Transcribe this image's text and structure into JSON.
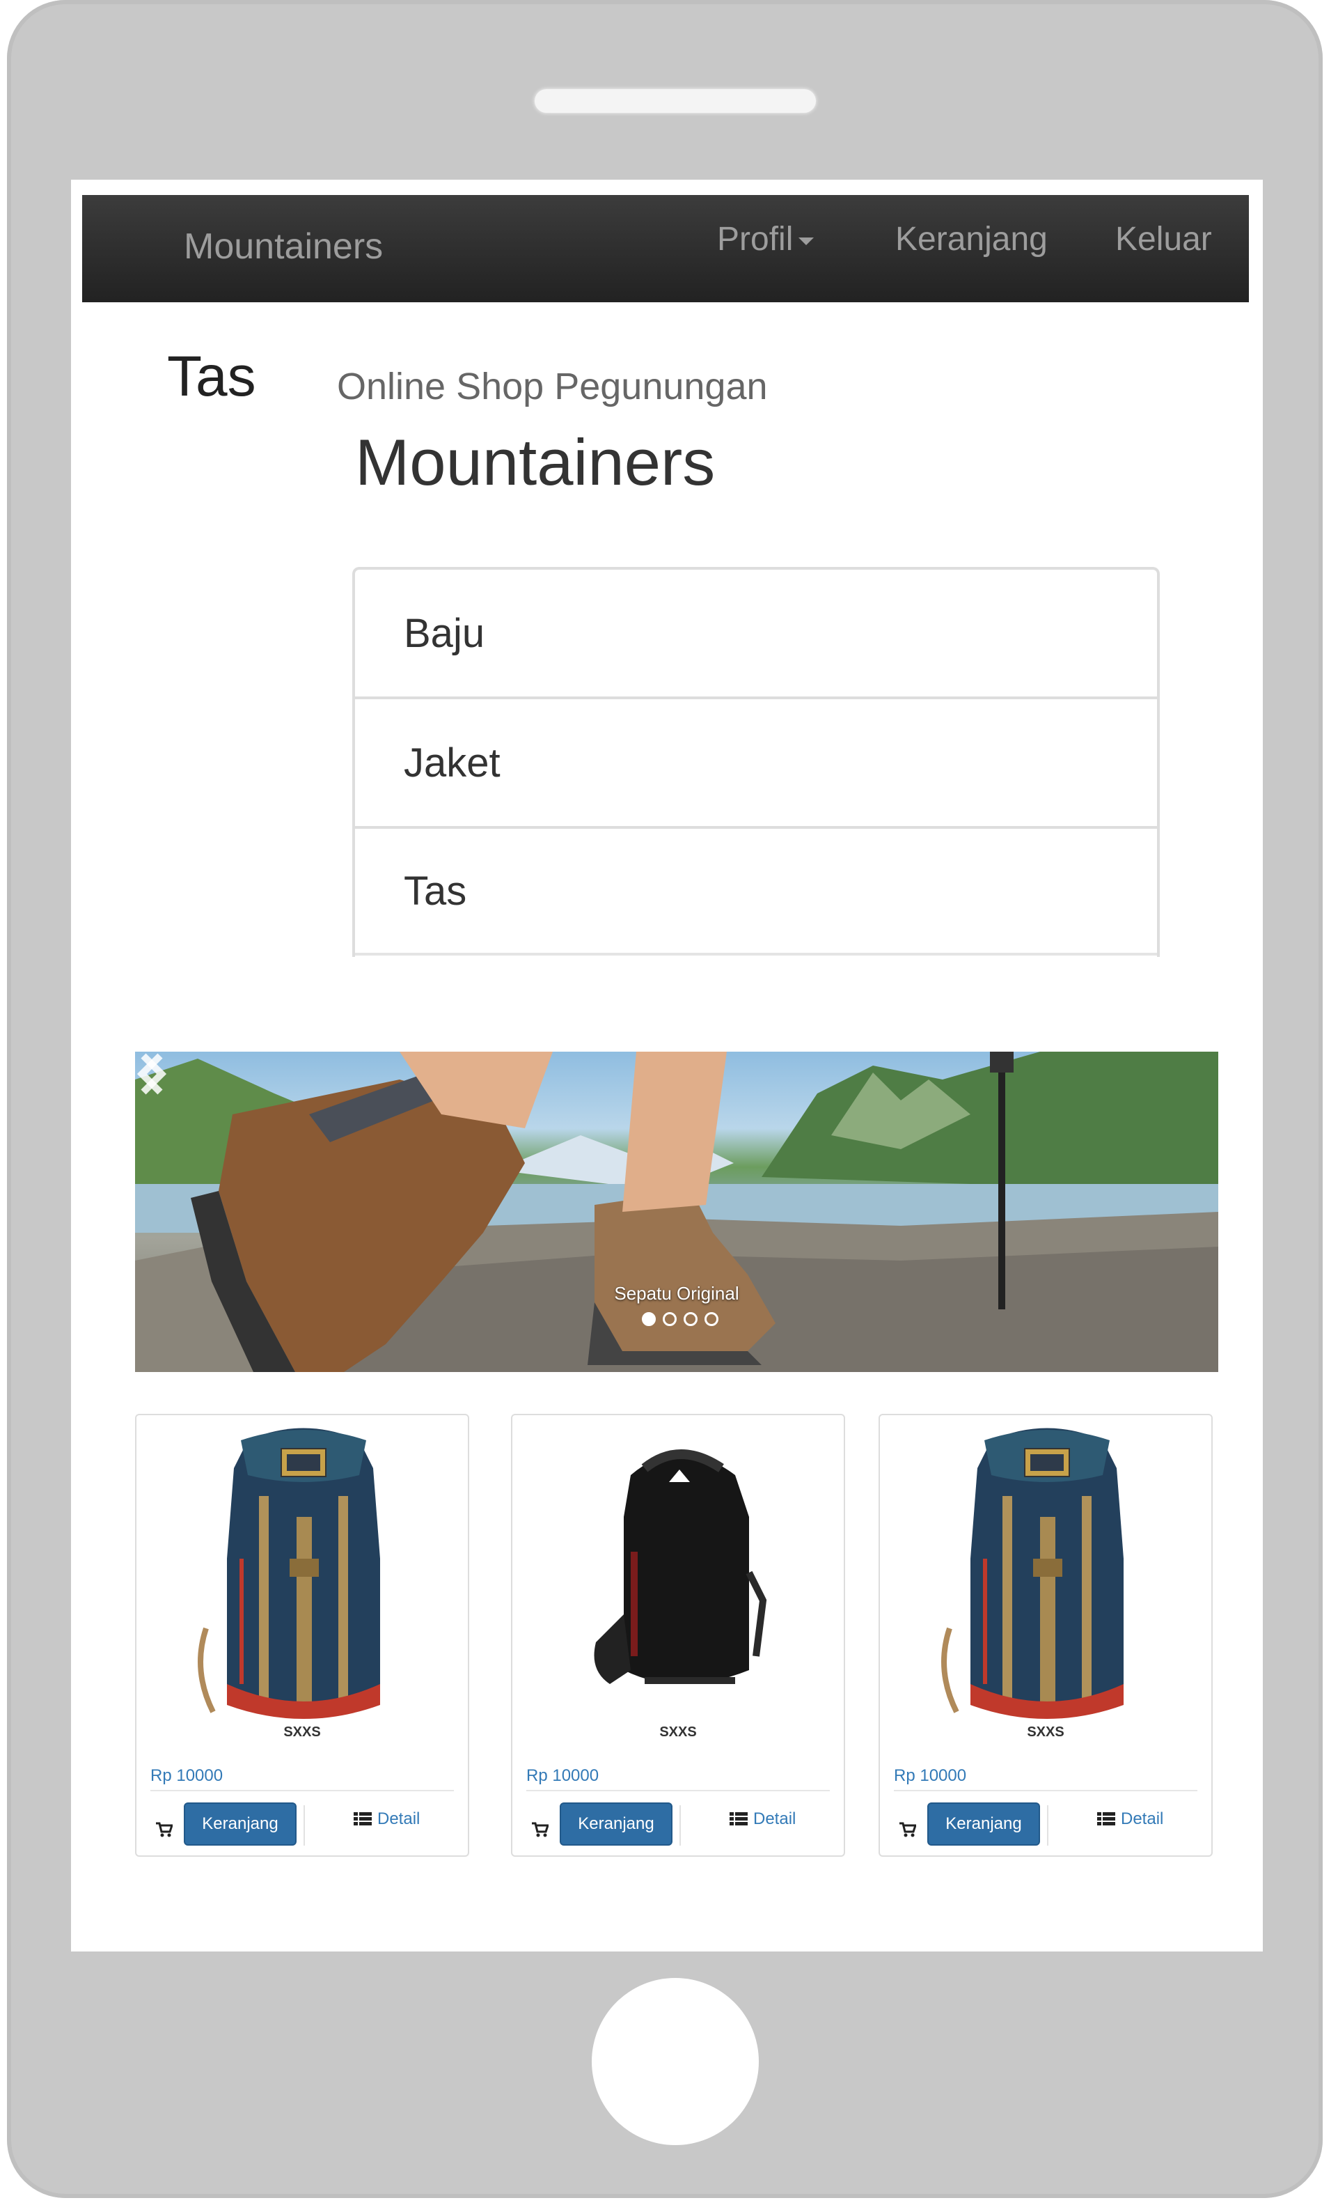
{
  "navbar": {
    "brand": "Mountainers",
    "items": [
      {
        "label": "Profil"
      },
      {
        "label": "Keranjang"
      },
      {
        "label": "Keluar"
      }
    ]
  },
  "header": {
    "title": "Tas",
    "subtitle": "Online Shop Pegunungan"
  },
  "sidebar": {
    "title": "Mountainers",
    "categories": [
      {
        "label": "Baju"
      },
      {
        "label": "Jaket"
      },
      {
        "label": "Tas"
      }
    ]
  },
  "carousel": {
    "caption": "Sepatu Original",
    "slide_count": 4,
    "active_index": 0
  },
  "products": [
    {
      "name": "SXXS",
      "price": "Rp 10000",
      "cart_label": "Keranjang",
      "detail_label": "Detail",
      "image": "blue-hiking-backpack"
    },
    {
      "name": "SXXS",
      "price": "Rp 10000",
      "cart_label": "Keranjang",
      "detail_label": "Detail",
      "image": "black-daypack"
    },
    {
      "name": "SXXS",
      "price": "Rp 10000",
      "cart_label": "Keranjang",
      "detail_label": "Detail",
      "image": "blue-hiking-backpack"
    }
  ],
  "colors": {
    "navbar_bg": "#222222",
    "link": "#337ab7",
    "button": "#2e6da4",
    "phone_frame": "#c8c8c8"
  }
}
